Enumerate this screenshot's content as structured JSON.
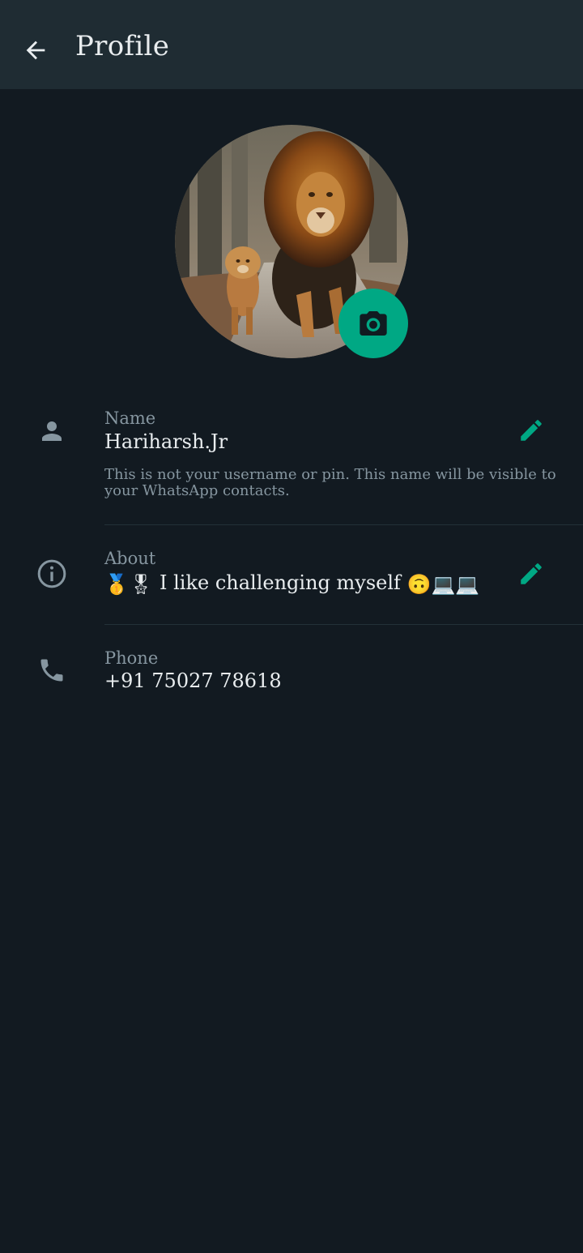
{
  "header": {
    "title": "Profile",
    "back_icon": "arrow-left-icon"
  },
  "profile_photo": {
    "subject": "lion and cub walking on a forest path",
    "camera_icon": "camera-icon"
  },
  "name": {
    "label": "Name",
    "value": "Hariharsh.Jr",
    "hint": "This is not your username or pin. This name will be visible to your WhatsApp contacts.",
    "icon": "person-icon",
    "edit_icon": "pencil-icon"
  },
  "about": {
    "label": "About",
    "text": "I like challenging myself",
    "leading_emojis": "🥇🎖",
    "trailing_emojis": "🙃💻💻",
    "icon": "info-icon",
    "edit_icon": "pencil-icon"
  },
  "phone": {
    "label": "Phone",
    "value": "+91 75027 78618",
    "icon": "phone-icon"
  },
  "colors": {
    "accent": "#00a884",
    "header_bg": "#1f2c33",
    "page_bg": "#121a21",
    "secondary_text": "#8696a0",
    "primary_text": "#e9edef"
  }
}
